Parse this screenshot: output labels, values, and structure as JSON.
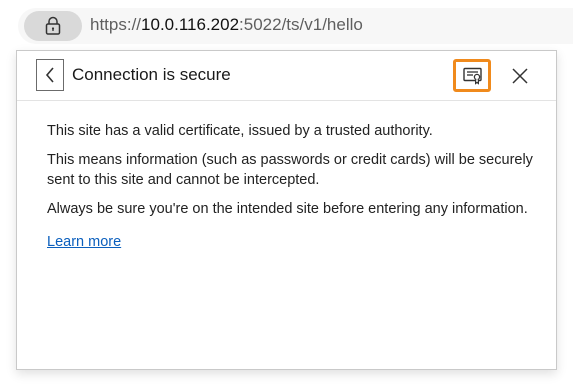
{
  "address_bar": {
    "url_scheme": "https://",
    "url_host": "10.0.116.202",
    "url_rest": ":5022/ts/v1/hello",
    "lock_icon": "lock-icon"
  },
  "popup": {
    "title": "Connection is secure",
    "back_icon": "chevron-left-icon",
    "certificate_icon": "certificate-icon",
    "close_icon": "close-icon",
    "accent_color": "#f08a1c",
    "paragraphs": [
      "This site has a valid certificate, issued by a trusted authority.",
      "This means information (such as passwords or credit cards) will be securely sent to this site and cannot be intercepted.",
      "Always be sure you're on the intended site before entering any information."
    ],
    "learn_more": "Learn more",
    "link_color": "#0b5fbd"
  }
}
